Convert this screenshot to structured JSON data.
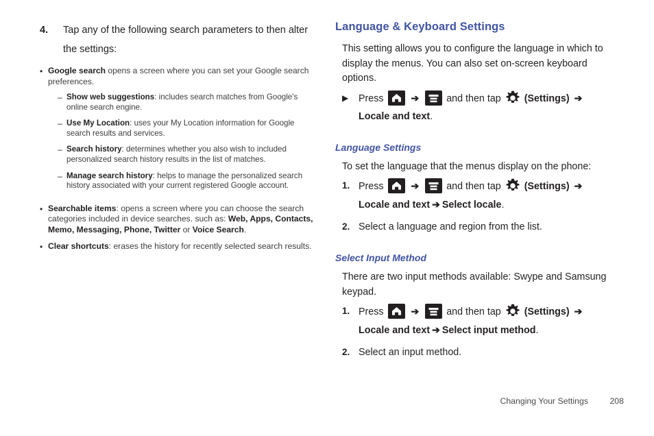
{
  "document": {
    "footer_label": "Changing Your Settings",
    "page_number": "208",
    "heading_color": "#4154a3",
    "body_color": "#231f20"
  },
  "left_column": {
    "step_number": "4.",
    "step_text": "Tap any of the following search parameters to then alter the settings:",
    "bullets": [
      {
        "marker": "•",
        "bold": "Google search",
        "rest": " opens a screen where you can set your Google search preferences.",
        "sub_items": [
          {
            "marker": "–",
            "bold": "Show web suggestions",
            "rest": ": includes search matches from Google's online search engine."
          },
          {
            "marker": "–",
            "bold": "Use My Location",
            "rest": ": uses your My Location information for Google search results and services."
          },
          {
            "marker": "–",
            "bold": "Search history",
            "rest": ": determines whether you also wish to included personalized search history results in the list of matches."
          },
          {
            "marker": "–",
            "bold": "Manage search history",
            "rest": ": helps to manage the personalized search history associated with your current registered Google account."
          }
        ]
      },
      {
        "marker": "•",
        "bold": "Searchable items",
        "rest": ": opens a screen where you can choose the search categories included in device searches. such as: ",
        "bold_tail_items": [
          "Web",
          "Apps",
          "Contacts",
          "Memo",
          "Messaging",
          "Phone",
          "Twitter"
        ],
        "tail_conjunction": " or ",
        "tail_last": "Voice Search",
        "tail_period": "."
      },
      {
        "marker": "•",
        "bold": "Clear shortcuts",
        "rest": ": erases the history for recently selected search results."
      }
    ]
  },
  "right_column": {
    "section_title": "Language & Keyboard Settings",
    "intro": "This setting allows you to configure the language in which to display the menus. You can also set on-screen keyboard options.",
    "intro_step": {
      "marker": "▶",
      "press_label": "Press",
      "icon_home": "home-icon",
      "arrow": "➔",
      "icon_menu": "menu-icon",
      "middle_label": "and then tap",
      "icon_gear": "gear-icon",
      "settings_label": "(Settings)",
      "path_bold": "Locale and text",
      "path_period": "."
    },
    "subsections": [
      {
        "title": "Language Settings",
        "lead": "To set the language that the menus display on the phone:",
        "steps": [
          {
            "number": "1.",
            "press_label": "Press",
            "arrow": "➔",
            "middle_label": "and then tap",
            "settings_label": "(Settings)",
            "path_bold_1": "Locale and text",
            "path_bold_2": "Select locale",
            "path_period": "."
          },
          {
            "number": "2.",
            "text": "Select a language and region from the list."
          }
        ]
      },
      {
        "title": "Select Input Method",
        "lead": "There are two input methods available: Swype and Samsung keypad.",
        "steps": [
          {
            "number": "1.",
            "press_label": "Press",
            "arrow": "➔",
            "middle_label": "and then tap",
            "settings_label": "(Settings)",
            "path_bold_1": "Locale and text",
            "path_bold_2": "Select input method",
            "path_period": "."
          },
          {
            "number": "2.",
            "text": "Select an input method."
          }
        ]
      }
    ]
  }
}
